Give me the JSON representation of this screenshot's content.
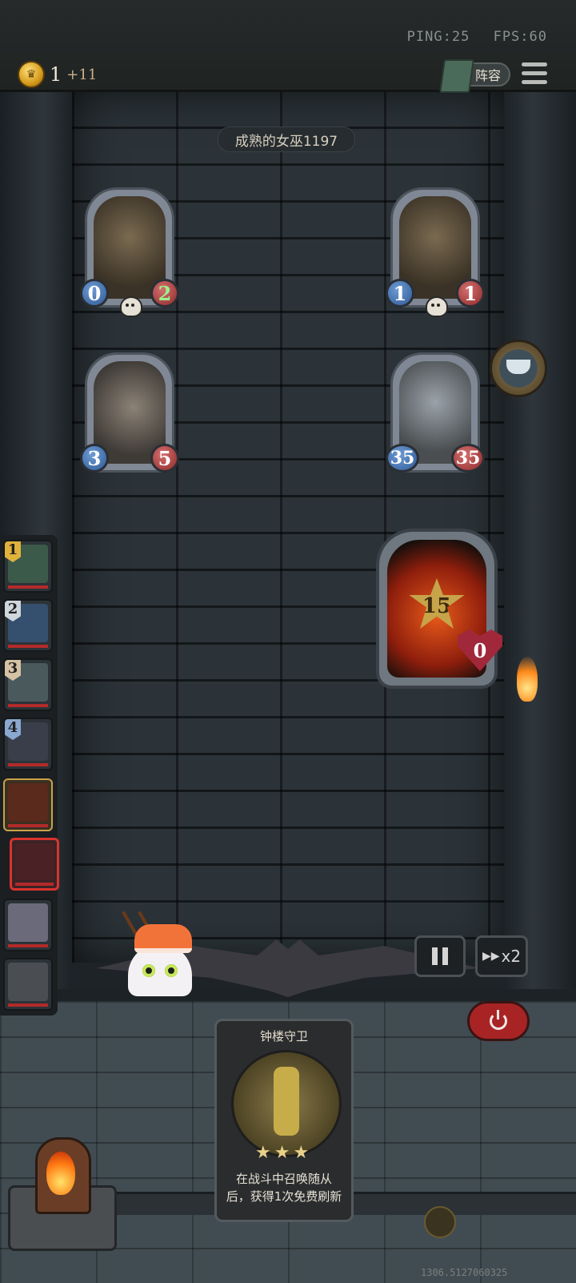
{
  "status": {
    "ping": "PING:25",
    "fps": "FPS:60"
  },
  "gold": {
    "amount": "1",
    "income": "+11"
  },
  "header": {
    "lineup_label": "阵容"
  },
  "opponent": {
    "name": "成熟的女巫1197"
  },
  "board": {
    "units": [
      {
        "id": "enemy-top-left",
        "attack": "0",
        "health": "2",
        "health_buffed": true,
        "has_skull": true
      },
      {
        "id": "enemy-top-right",
        "attack": "1",
        "health": "1",
        "health_buffed": false,
        "has_skull": true
      },
      {
        "id": "mid-left-beast",
        "attack": "3",
        "health": "5",
        "health_buffed": false,
        "has_skull": false
      },
      {
        "id": "mid-right-robot",
        "attack": "35",
        "health": "35",
        "health_buffed": false,
        "has_skull": false
      }
    ]
  },
  "hero": {
    "level": "15",
    "health": "0"
  },
  "queue": {
    "slots": [
      "1",
      "2",
      "3",
      "4"
    ]
  },
  "controls": {
    "speed_label": "x2"
  },
  "shop_card": {
    "name": "钟楼守卫",
    "stars": 3,
    "description_line1": "在战斗中召唤随从",
    "description_line2": "后，获得1次免费刷新"
  },
  "debug": {
    "text": "1306.5127060325"
  },
  "colors": {
    "attack": "#2e5a96",
    "health": "#8e2a2a",
    "buff": "#9cf08a",
    "danger": "#a82424"
  }
}
